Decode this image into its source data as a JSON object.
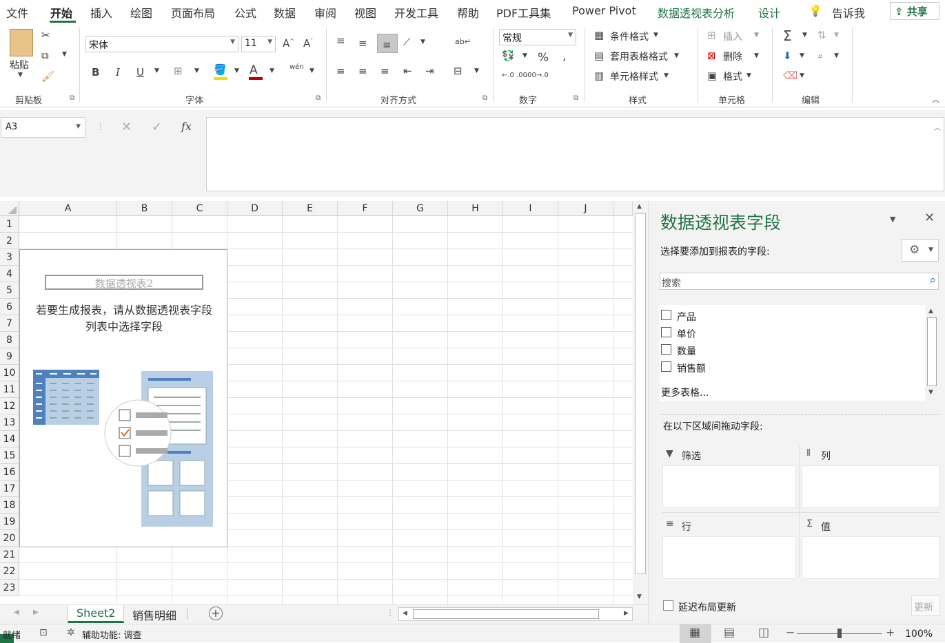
{
  "menu": {
    "tabs": [
      "文件",
      "开始",
      "插入",
      "绘图",
      "页面布局",
      "公式",
      "数据",
      "审阅",
      "视图",
      "开发工具",
      "帮助",
      "PDF工具集",
      "Power Pivot",
      "数据透视表分析",
      "设计"
    ],
    "tell_me": "告诉我",
    "share": "共享"
  },
  "ribbon": {
    "clipboard": {
      "paste": "粘贴",
      "label": "剪贴板"
    },
    "font": {
      "name": "宋体",
      "size": "11",
      "bold": "B",
      "italic": "I",
      "underline": "U",
      "label": "字体",
      "phonetic": "wén"
    },
    "alignment": {
      "label": "对齐方式"
    },
    "number": {
      "format": "常规",
      "percent": "%",
      "comma": ",",
      "label": "数字"
    },
    "styles": {
      "conditional": "条件格式",
      "table_format": "套用表格格式",
      "cell_styles": "单元格样式",
      "label": "样式"
    },
    "cells": {
      "insert": "插入",
      "delete": "删除",
      "format": "格式",
      "label": "单元格"
    },
    "editing": {
      "label": "编辑"
    }
  },
  "formula_bar": {
    "name_box": "A3",
    "cancel": "✕",
    "enter": "✓",
    "fx": "fx",
    "value": ""
  },
  "sheet": {
    "columns": [
      "A",
      "B",
      "C",
      "D",
      "E",
      "F",
      "G",
      "H",
      "I",
      "J"
    ],
    "rows": [
      "1",
      "2",
      "3",
      "4",
      "5",
      "6",
      "7",
      "8",
      "9",
      "10",
      "11",
      "12",
      "13",
      "14",
      "15",
      "16",
      "17",
      "18",
      "19",
      "20",
      "21",
      "22",
      "23"
    ],
    "pivot": {
      "name": "数据透视表2",
      "message_line1": "若要生成报表，请从数据透视表字段",
      "message_line2": "列表中选择字段"
    }
  },
  "sheet_tabs": {
    "tabs": [
      "Sheet2",
      "销售明细"
    ],
    "active": "Sheet2"
  },
  "pane": {
    "title": "数据透视表字段",
    "subtitle": "选择要添加到报表的字段:",
    "search_placeholder": "搜索",
    "fields": [
      "产品",
      "单价",
      "数量",
      "销售额"
    ],
    "more_tables": "更多表格...",
    "drag_hint": "在以下区域间拖动字段:",
    "zones": {
      "filter": "筛选",
      "columns": "列",
      "rows": "行",
      "values": "值"
    },
    "defer": "延迟布局更新",
    "update": "更新"
  },
  "status": {
    "ready": "就绪",
    "accessibility": "辅助功能: 调查",
    "zoom": "100%"
  },
  "colors": {
    "accent": "#217346"
  }
}
